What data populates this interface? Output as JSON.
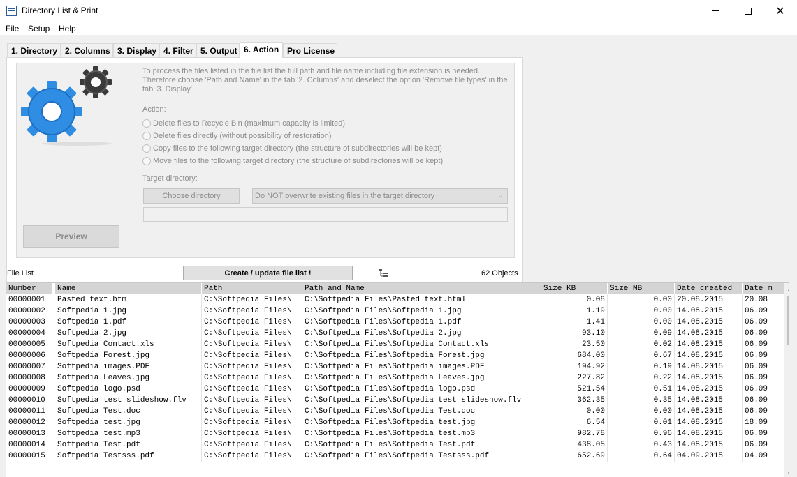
{
  "window": {
    "title": "Directory List & Print",
    "minimize": "—",
    "close": "✕"
  },
  "menu": [
    "File",
    "Setup",
    "Help"
  ],
  "tabs": [
    {
      "label": "1. Directory",
      "active": false
    },
    {
      "label": "2. Columns",
      "active": false
    },
    {
      "label": "3. Display",
      "active": false
    },
    {
      "label": "4. Filter",
      "active": false
    },
    {
      "label": "5. Output",
      "active": false
    },
    {
      "label": "6. Action",
      "active": true
    },
    {
      "label": "Pro License",
      "active": false
    }
  ],
  "action_panel": {
    "info": "To process the files listed in the file list the full path and file name including file extension is needed. Therefore choose 'Path and Name' in the tab '2. Columns' and deselect the option 'Remove file types' in the tab '3. Display'.",
    "action_label": "Action:",
    "options": [
      "Delete files to Recycle Bin (maximum capacity is limited)",
      "Delete files directly (without possibility of restoration)",
      "Copy files to the following target directory (the structure of subdirectories will be kept)",
      "Move files to the following target directory (the structure of subdirectories will be kept)"
    ],
    "target_label": "Target directory:",
    "choose_directory": "Choose directory",
    "overwrite_select": "Do NOT overwrite existing files in the target directory",
    "target_path": "",
    "preview": "Preview"
  },
  "filelist": {
    "label": "File List",
    "create_button": "Create / update file list !",
    "objects": "62 Objects",
    "columns": [
      "Number",
      "Name",
      "Path",
      "Path and Name",
      "Size KB",
      "Size MB",
      "Date created",
      "Date m"
    ],
    "rows": [
      [
        "00000001",
        "Pasted text.html",
        "C:\\Softpedia Files\\",
        "C:\\Softpedia Files\\Pasted text.html",
        "0.08",
        "0.00",
        "20.08.2015",
        "20.08"
      ],
      [
        "00000002",
        "Softpedia 1.jpg",
        "C:\\Softpedia Files\\",
        "C:\\Softpedia Files\\Softpedia 1.jpg",
        "1.19",
        "0.00",
        "14.08.2015",
        "06.09"
      ],
      [
        "00000003",
        "Softpedia 1.pdf",
        "C:\\Softpedia Files\\",
        "C:\\Softpedia Files\\Softpedia 1.pdf",
        "1.41",
        "0.00",
        "14.08.2015",
        "06.09"
      ],
      [
        "00000004",
        "Softpedia 2.jpg",
        "C:\\Softpedia Files\\",
        "C:\\Softpedia Files\\Softpedia 2.jpg",
        "93.10",
        "0.09",
        "14.08.2015",
        "06.09"
      ],
      [
        "00000005",
        "Softpedia Contact.xls",
        "C:\\Softpedia Files\\",
        "C:\\Softpedia Files\\Softpedia Contact.xls",
        "23.50",
        "0.02",
        "14.08.2015",
        "06.09"
      ],
      [
        "00000006",
        "Softpedia Forest.jpg",
        "C:\\Softpedia Files\\",
        "C:\\Softpedia Files\\Softpedia Forest.jpg",
        "684.00",
        "0.67",
        "14.08.2015",
        "06.09"
      ],
      [
        "00000007",
        "Softpedia images.PDF",
        "C:\\Softpedia Files\\",
        "C:\\Softpedia Files\\Softpedia images.PDF",
        "194.92",
        "0.19",
        "14.08.2015",
        "06.09"
      ],
      [
        "00000008",
        "Softpedia Leaves.jpg",
        "C:\\Softpedia Files\\",
        "C:\\Softpedia Files\\Softpedia Leaves.jpg",
        "227.82",
        "0.22",
        "14.08.2015",
        "06.09"
      ],
      [
        "00000009",
        "Softpedia logo.psd",
        "C:\\Softpedia Files\\",
        "C:\\Softpedia Files\\Softpedia logo.psd",
        "521.54",
        "0.51",
        "14.08.2015",
        "06.09"
      ],
      [
        "00000010",
        "Softpedia test slideshow.flv",
        "C:\\Softpedia Files\\",
        "C:\\Softpedia Files\\Softpedia test slideshow.flv",
        "362.35",
        "0.35",
        "14.08.2015",
        "06.09"
      ],
      [
        "00000011",
        "Softpedia Test.doc",
        "C:\\Softpedia Files\\",
        "C:\\Softpedia Files\\Softpedia Test.doc",
        "0.00",
        "0.00",
        "14.08.2015",
        "06.09"
      ],
      [
        "00000012",
        "Softpedia test.jpg",
        "C:\\Softpedia Files\\",
        "C:\\Softpedia Files\\Softpedia test.jpg",
        "6.54",
        "0.01",
        "14.08.2015",
        "18.09"
      ],
      [
        "00000013",
        "Softpedia test.mp3",
        "C:\\Softpedia Files\\",
        "C:\\Softpedia Files\\Softpedia test.mp3",
        "982.78",
        "0.96",
        "14.08.2015",
        "06.09"
      ],
      [
        "00000014",
        "Softpedia Test.pdf",
        "C:\\Softpedia Files\\",
        "C:\\Softpedia Files\\Softpedia Test.pdf",
        "438.05",
        "0.43",
        "14.08.2015",
        "06.09"
      ],
      [
        "00000015",
        "Softpedia Testsss.pdf",
        "C:\\Softpedia Files\\",
        "C:\\Softpedia Files\\Softpedia Testsss.pdf",
        "652.69",
        "0.64",
        "04.09.2015",
        "04.09"
      ]
    ]
  },
  "icons": {
    "app": "list-document-icon",
    "gears": "gears-icon",
    "tree": "tree-view-icon"
  },
  "colors": {
    "gear_blue": "#2f8de4",
    "gear_dark": "#3a3a3a",
    "header_bg": "#d4d4d4",
    "disabled_text": "#8c8c8c"
  }
}
